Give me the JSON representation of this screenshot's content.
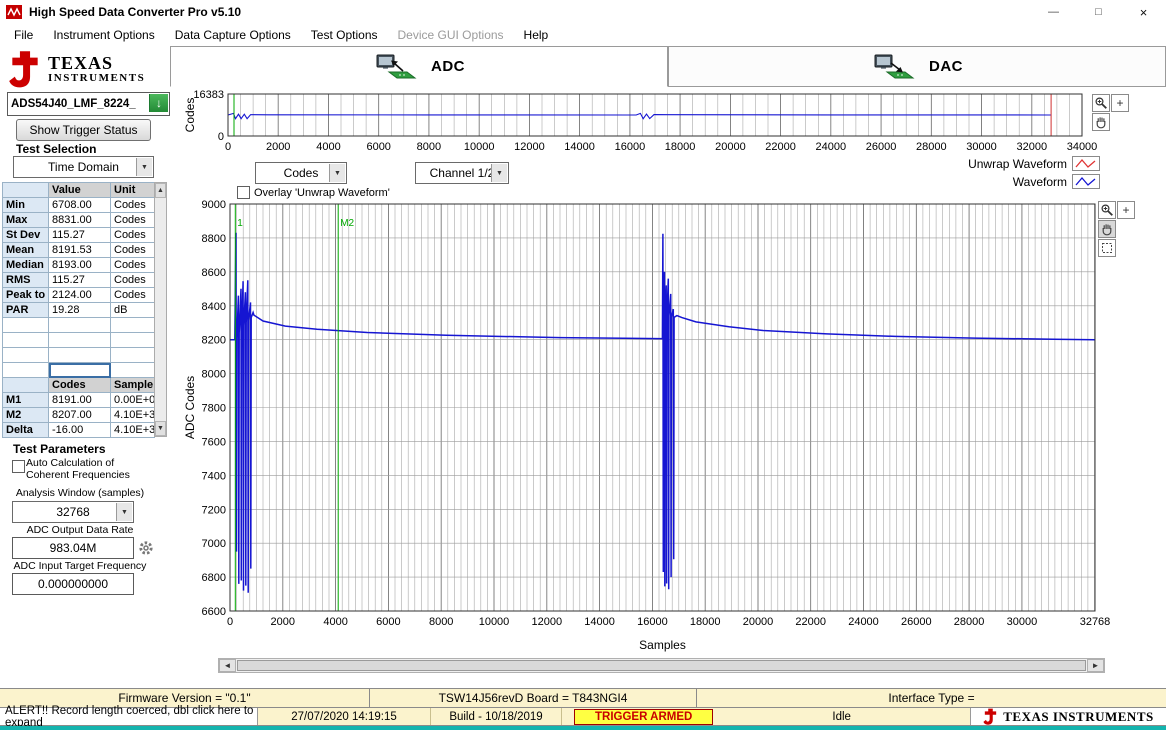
{
  "window": {
    "title": "High Speed Data Converter Pro v5.10"
  },
  "icons": {
    "minimize": "—",
    "maximize": "□",
    "close": "×",
    "combo_arrow": "▼",
    "scroll_up": "▲",
    "scroll_down": "▼",
    "scroll_left": "◄",
    "scroll_right": "►",
    "load_arrow": "↓"
  },
  "menu": {
    "items": [
      {
        "label": "File",
        "enabled": true
      },
      {
        "label": "Instrument Options",
        "enabled": true
      },
      {
        "label": "Data Capture Options",
        "enabled": true
      },
      {
        "label": "Test Options",
        "enabled": true
      },
      {
        "label": "Device GUI Options",
        "enabled": false
      },
      {
        "label": "Help",
        "enabled": true
      }
    ]
  },
  "sidebar": {
    "brand": {
      "line1": "TEXAS",
      "line2": "INSTRUMENTS"
    },
    "device_value": "ADS54J40_LMF_8224_",
    "show_trigger_label": "Show Trigger Status",
    "test_selection_label": "Test Selection",
    "test_selection_value": "Time Domain",
    "stats_table": {
      "value_header": "Value",
      "unit_header": "Unit",
      "rows": [
        {
          "label": "Min",
          "value": "6708.00",
          "unit": "Codes"
        },
        {
          "label": "Max",
          "value": "8831.00",
          "unit": "Codes"
        },
        {
          "label": "St Dev",
          "value": "115.27",
          "unit": "Codes"
        },
        {
          "label": "Mean",
          "value": "8191.53",
          "unit": "Codes"
        },
        {
          "label": "Median",
          "value": "8193.00",
          "unit": "Codes"
        },
        {
          "label": "RMS",
          "value": "115.27",
          "unit": "Codes"
        },
        {
          "label": "Peak to P",
          "value": "2124.00",
          "unit": "Codes"
        },
        {
          "label": "PAR",
          "value": "19.28",
          "unit": "dB"
        }
      ],
      "blank_rows": 4,
      "marker_header": {
        "col1": "Codes",
        "col2": "Sample"
      },
      "marker_rows": [
        {
          "label": "M1",
          "value": "8191.00",
          "sample": "0.00E+0"
        },
        {
          "label": "M2",
          "value": "8207.00",
          "sample": "4.10E+3"
        },
        {
          "label": "Delta",
          "value": "-16.00",
          "sample": "4.10E+3"
        }
      ]
    },
    "test_parameters": {
      "title": "Test Parameters",
      "auto_calc_line1": "Auto Calculation of",
      "auto_calc_line2": "Coherent Frequencies",
      "analysis_window_label": "Analysis Window (samples)",
      "analysis_window_value": "32768",
      "adc_output_rate_label": "ADC Output Data Rate",
      "adc_output_rate_value": "983.04M",
      "adc_input_freq_label": "ADC Input Target Frequency",
      "adc_input_freq_value": "0.000000000"
    }
  },
  "tabs": {
    "adc": "ADC",
    "dac": "DAC"
  },
  "plot_controls": {
    "codes_select": "Codes",
    "channel_select": "Channel 1/2",
    "overlay_label": "Overlay 'Unwrap Waveform'",
    "legend": [
      {
        "label": "Unwrap Waveform",
        "color": "#e03434"
      },
      {
        "label": "Waveform",
        "color": "#1515d2"
      }
    ]
  },
  "statusbar": {
    "row1": {
      "firmware": "Firmware Version = \"0.1\"",
      "board": "TSW14J56revD Board = T843NGI4",
      "interface": "Interface Type ="
    },
    "row2": {
      "alert": "ALERT!! Record length coerced, dbl click here to expand",
      "datetime": "27/07/2020 14:19:15",
      "build": "Build  - 10/18/2019",
      "trigger": "TRIGGER ARMED",
      "state": "Idle",
      "brand": "TEXAS INSTRUMENTS"
    }
  },
  "chart_data": [
    {
      "id": "overview",
      "type": "line",
      "title": "",
      "xlabel": "",
      "ylabel": "Codes",
      "xlim": [
        0,
        34000
      ],
      "ylim": [
        0,
        16383
      ],
      "xticks": [
        0,
        2000,
        4000,
        6000,
        8000,
        10000,
        12000,
        14000,
        16000,
        18000,
        20000,
        22000,
        24000,
        26000,
        28000,
        30000,
        32000,
        34000
      ],
      "yticks": [
        0,
        16383
      ],
      "grid": {
        "x_minor": 500
      },
      "cursors": [
        {
          "x": 240,
          "color": "#00a800"
        },
        {
          "x": 32768,
          "color": "#d03030"
        }
      ],
      "series": [
        {
          "name": "Waveform",
          "color": "#1515d2",
          "width": 1.1,
          "points": [
            [
              0,
              8200
            ],
            [
              220,
              8830
            ],
            [
              300,
              6750
            ],
            [
              420,
              8500
            ],
            [
              520,
              6740
            ],
            [
              650,
              8500
            ],
            [
              760,
              6750
            ],
            [
              900,
              8320
            ],
            [
              1600,
              8265
            ],
            [
              8000,
              8225
            ],
            [
              16250,
              8210
            ],
            [
              16420,
              8830
            ],
            [
              16530,
              6740
            ],
            [
              16660,
              8550
            ],
            [
              16790,
              6770
            ],
            [
              16960,
              8360
            ],
            [
              17500,
              8300
            ],
            [
              24000,
              8230
            ],
            [
              32768,
              8200
            ]
          ]
        }
      ]
    },
    {
      "id": "main",
      "type": "line",
      "title": "",
      "xlabel": "Samples",
      "ylabel": "ADC Codes",
      "xlim": [
        0,
        32768
      ],
      "ylim": [
        6600,
        9000
      ],
      "xticks": [
        0,
        2000,
        4000,
        6000,
        8000,
        10000,
        12000,
        14000,
        16000,
        18000,
        20000,
        22000,
        24000,
        26000,
        28000,
        30000,
        32768
      ],
      "yticks": [
        6600,
        6800,
        7000,
        7200,
        7400,
        7600,
        7800,
        8000,
        8200,
        8400,
        8600,
        8800,
        9000
      ],
      "grid": {
        "x_minor": 250
      },
      "legend_position": "top-right",
      "cursors": [
        {
          "x": 200,
          "label": "1",
          "color": "#00a800"
        },
        {
          "x": 4100,
          "label": "M2",
          "color": "#00a800"
        }
      ],
      "series": [
        {
          "name": "Waveform",
          "color": "#1515d2",
          "width": 1.5,
          "points": [
            [
              0,
              8200
            ],
            [
              180,
              8200
            ],
            [
              225,
              8830
            ],
            [
              245,
              6950
            ],
            [
              260,
              8210
            ],
            [
              320,
              8460
            ],
            [
              332,
              6760
            ],
            [
              348,
              8240
            ],
            [
              415,
              8500
            ],
            [
              428,
              6780
            ],
            [
              442,
              8260
            ],
            [
              498,
              8545
            ],
            [
              510,
              6720
            ],
            [
              524,
              8285
            ],
            [
              585,
              8480
            ],
            [
              598,
              6750
            ],
            [
              612,
              8300
            ],
            [
              676,
              8550
            ],
            [
              690,
              6708
            ],
            [
              704,
              8315
            ],
            [
              775,
              8420
            ],
            [
              788,
              6850
            ],
            [
              802,
              8330
            ],
            [
              875,
              8360
            ],
            [
              905,
              8345
            ],
            [
              1250,
              8310
            ],
            [
              2100,
              8280
            ],
            [
              3300,
              8262
            ],
            [
              5200,
              8242
            ],
            [
              8200,
              8226
            ],
            [
              12500,
              8212
            ],
            [
              16250,
              8206
            ],
            [
              16380,
              8206
            ],
            [
              16400,
              8825
            ],
            [
              16413,
              6830
            ],
            [
              16428,
              8400
            ],
            [
              16458,
              8600
            ],
            [
              16470,
              6745
            ],
            [
              16484,
              8350
            ],
            [
              16525,
              8520
            ],
            [
              16538,
              6762
            ],
            [
              16552,
              8332
            ],
            [
              16605,
              8560
            ],
            [
              16618,
              6728
            ],
            [
              16632,
              8342
            ],
            [
              16695,
              8470
            ],
            [
              16708,
              6800
            ],
            [
              16722,
              8332
            ],
            [
              16795,
              8380
            ],
            [
              16808,
              6905
            ],
            [
              16822,
              8332
            ],
            [
              16930,
              8342
            ],
            [
              17120,
              8330
            ],
            [
              17650,
              8305
            ],
            [
              18900,
              8276
            ],
            [
              20200,
              8254
            ],
            [
              22600,
              8234
            ],
            [
              25200,
              8219
            ],
            [
              28200,
              8209
            ],
            [
              31200,
              8203
            ],
            [
              32768,
              8200
            ]
          ]
        }
      ]
    }
  ]
}
